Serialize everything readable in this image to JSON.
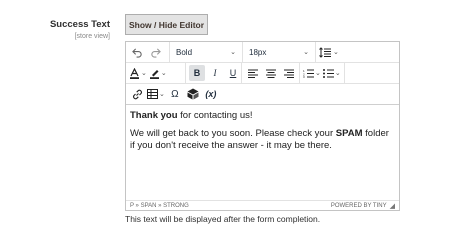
{
  "field": {
    "label": "Success Text",
    "scope": "[store view]"
  },
  "toggle_button": "Show / Hide Editor",
  "toolbar": {
    "block_format": "Bold",
    "font_size": "18px",
    "variable_label": "(x)"
  },
  "content": {
    "p1_bold": "Thank you",
    "p1_rest": " for contacting us!",
    "p2_a": "We will get back to you soon. Please check your ",
    "p2_bold": "SPAM",
    "p2_b": " folder if you don't receive the answer - it may be there."
  },
  "statusbar": {
    "path": "P » SPAN » STRONG",
    "brand": "POWERED BY TINY"
  },
  "note": "This text will be displayed after the form completion."
}
